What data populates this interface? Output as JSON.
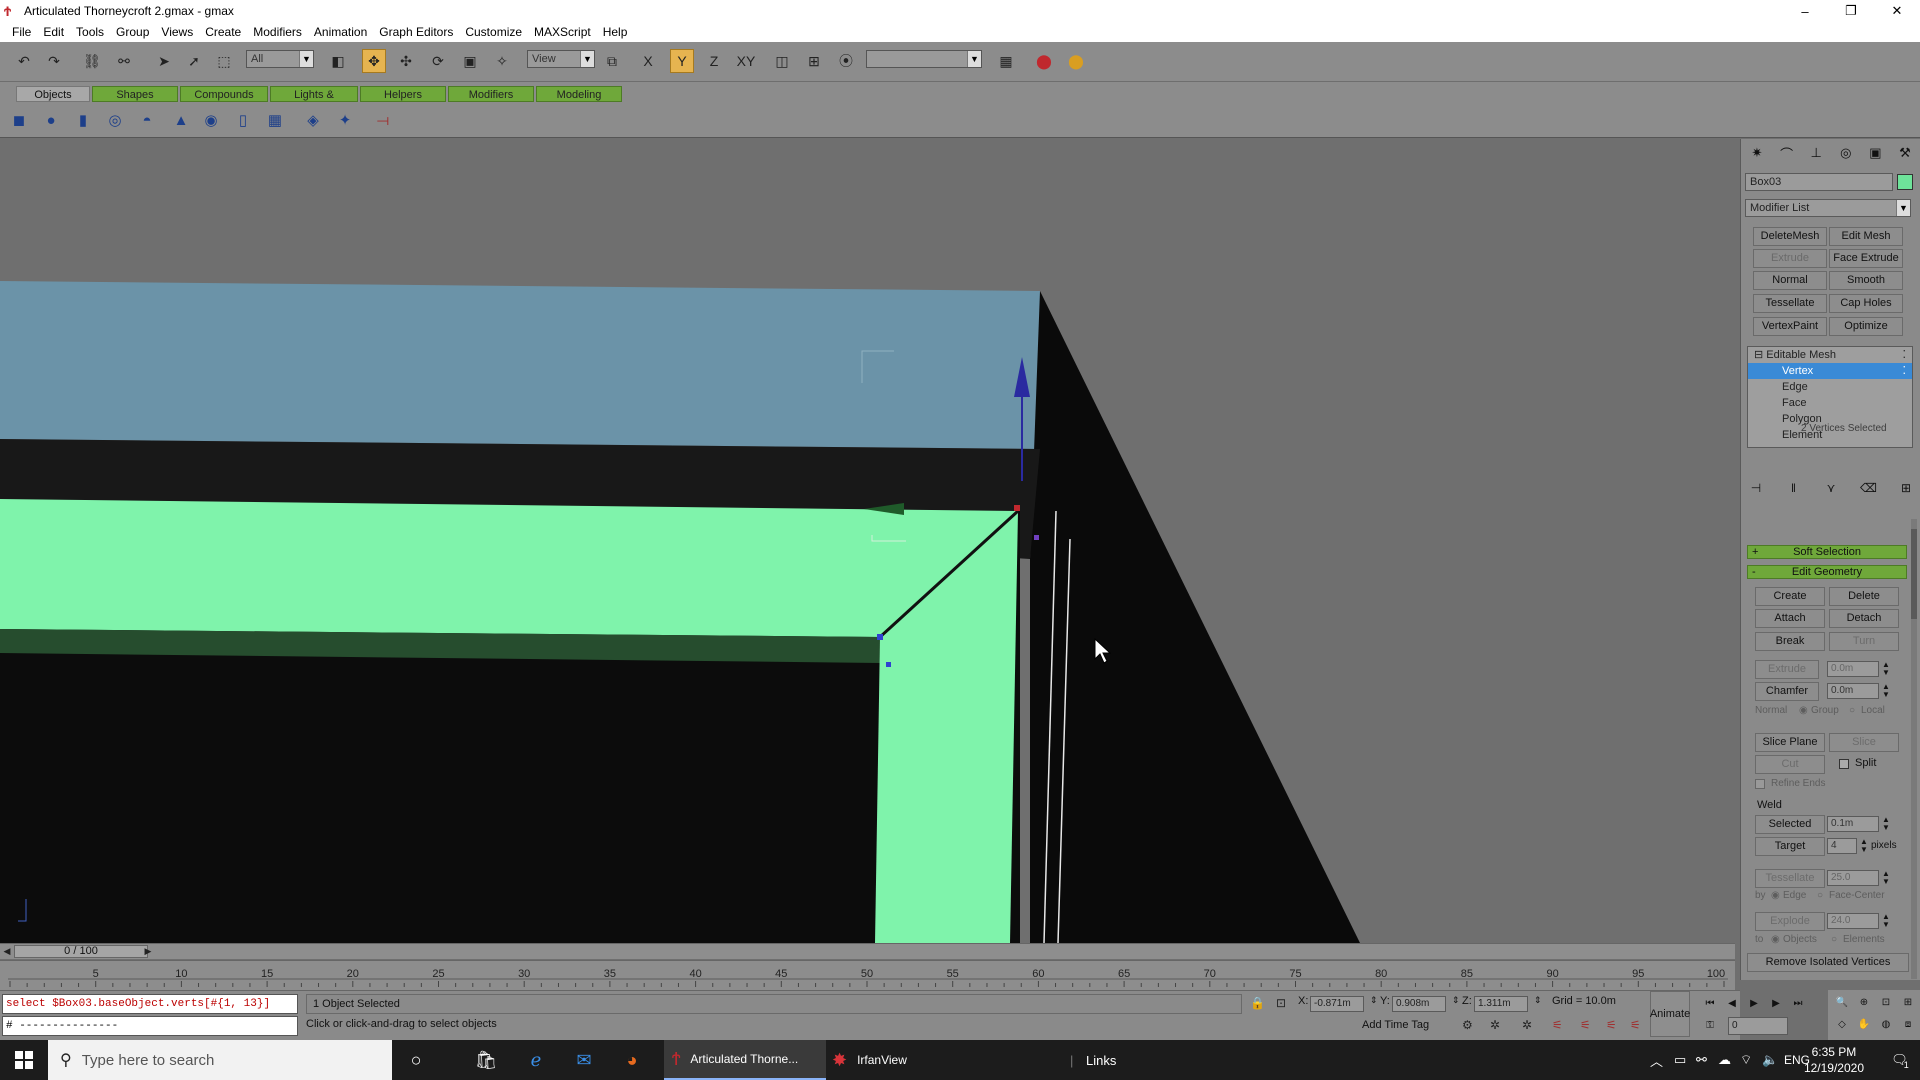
{
  "window": {
    "title": "Articulated Thorneycroft 2.gmax - gmax",
    "minimize": "–",
    "maximize": "❐",
    "close": "✕"
  },
  "menu": [
    "File",
    "Edit",
    "Tools",
    "Group",
    "Views",
    "Create",
    "Modifiers",
    "Animation",
    "Graph Editors",
    "Customize",
    "MAXScript",
    "Help"
  ],
  "toolbar": {
    "selection_filter": "All",
    "reference_coord": "View",
    "named_selection": ""
  },
  "tabs": [
    {
      "label": "Objects",
      "selected": true
    },
    {
      "label": "Shapes",
      "selected": false
    },
    {
      "label": "Compounds",
      "selected": false
    },
    {
      "label": "Lights & Cameras",
      "selected": false
    },
    {
      "label": "Helpers",
      "selected": false
    },
    {
      "label": "Modifiers",
      "selected": false
    },
    {
      "label": "Modeling",
      "selected": false
    }
  ],
  "command_panel": {
    "object_name": "Box03",
    "object_color": "#6ee39a",
    "modifier_list": "Modifier List",
    "modifier_buttons": [
      {
        "label": "DeleteMesh",
        "disabled": false
      },
      {
        "label": "Edit Mesh",
        "disabled": false
      },
      {
        "label": "Extrude",
        "disabled": true
      },
      {
        "label": "Face Extrude",
        "disabled": false
      },
      {
        "label": "Normal",
        "disabled": false
      },
      {
        "label": "Smooth",
        "disabled": false
      },
      {
        "label": "Tessellate",
        "disabled": false
      },
      {
        "label": "Cap Holes",
        "disabled": false
      },
      {
        "label": "VertexPaint",
        "disabled": false
      },
      {
        "label": "Optimize",
        "disabled": false
      }
    ],
    "stack": [
      {
        "label": "Editable Mesh",
        "selected": false
      },
      {
        "label": "Vertex",
        "selected": true
      },
      {
        "label": "Edge",
        "selected": false
      },
      {
        "label": "Face",
        "selected": false
      },
      {
        "label": "Polygon",
        "selected": false
      },
      {
        "label": "Element",
        "selected": false
      }
    ],
    "vertices_selected": "2 Vertices Selected",
    "soft_selection": "Soft Selection",
    "soft_selection_sign": "+",
    "edit_geometry": "Edit Geometry",
    "edit_geometry_sign": "-",
    "create": "Create",
    "delete": "Delete",
    "attach": "Attach",
    "detach": "Detach",
    "break": "Break",
    "turn": "Turn",
    "extrude": "Extrude",
    "extrude_value": "0.0m",
    "chamfer": "Chamfer",
    "chamfer_value": "0.0m",
    "normal": "Normal",
    "group": "Group",
    "local": "Local",
    "slice_plane": "Slice Plane",
    "slice": "Slice",
    "cut": "Cut",
    "split": "Split",
    "refine_ends": "Refine Ends",
    "weld": "Weld",
    "selected": "Selected",
    "selected_value": "0.1m",
    "target": "Target",
    "target_value": "4",
    "pixels": "pixels",
    "tessellate": "Tessellate",
    "tessellate_value": "25.0",
    "by": "by",
    "edge": "Edge",
    "face_center": "Face-Center",
    "explode": "Explode",
    "explode_value": "24.0",
    "to": "to",
    "objects": "Objects",
    "elements": "Elements",
    "remove_isolated": "Remove Isolated Vertices"
  },
  "timeline": {
    "frame": "0 / 100",
    "ticks": [
      "5",
      "10",
      "15",
      "20",
      "25",
      "30",
      "35",
      "40",
      "45",
      "50",
      "55",
      "60",
      "65",
      "70",
      "75",
      "80",
      "85",
      "90",
      "95",
      "100"
    ]
  },
  "status": {
    "maxscript_line": "select $Box03.baseObject.verts[#{1, 13}]",
    "maxscript_listener": "# ---------------",
    "selection": "1 Object Selected",
    "prompt": "Click or click-and-drag to select objects",
    "x_label": "X:",
    "x_value": "-0.871m",
    "y_label": "Y:",
    "y_value": "0.908m",
    "z_label": "Z:",
    "z_value": "1.311m",
    "grid": "Grid = 10.0m",
    "add_time_tag": "Add Time Tag",
    "animate": "Animate",
    "current_frame": "0"
  },
  "taskbar": {
    "search_placeholder": "Type here to search",
    "apps": [
      {
        "label": "Articulated Thorne...",
        "active": true
      },
      {
        "label": "IrfanView",
        "active": false
      }
    ],
    "links": "Links",
    "lang": "ENG",
    "time": "6:35 PM",
    "date": "12/19/2020",
    "notifications": "1"
  }
}
